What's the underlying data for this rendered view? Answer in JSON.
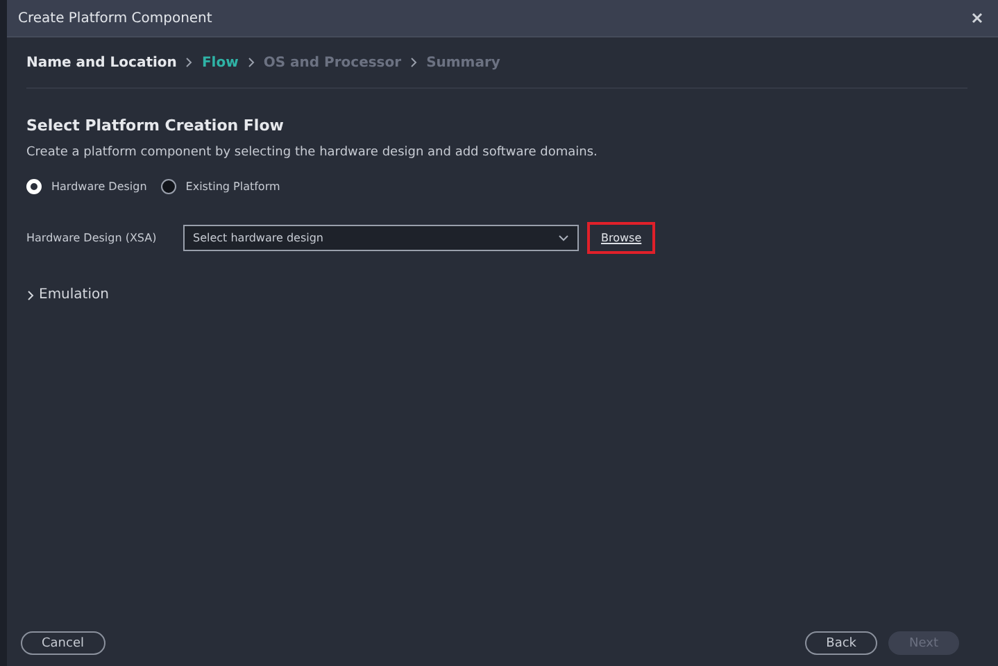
{
  "window": {
    "title": "Create Platform Component"
  },
  "steps": [
    {
      "label": "Name and Location",
      "selected": false,
      "disabled": false
    },
    {
      "label": "Flow",
      "selected": true,
      "disabled": false
    },
    {
      "label": "OS and Processor",
      "selected": false,
      "disabled": true
    },
    {
      "label": "Summary",
      "selected": false,
      "disabled": true
    }
  ],
  "section": {
    "title": "Select Platform Creation Flow",
    "description": "Create a platform component by selecting the hardware design and add software domains."
  },
  "flow_options": [
    {
      "label": "Hardware Design",
      "selected": true
    },
    {
      "label": "Existing Platform",
      "selected": false
    }
  ],
  "hardware_design": {
    "label": "Hardware Design (XSA)",
    "placeholder": "Select hardware design",
    "browse": {
      "label": "Browse",
      "highlighted": true
    }
  },
  "emulation": {
    "label": "Emulation",
    "expanded": false
  },
  "buttons": [
    {
      "label": "Cancel",
      "disabled": false
    },
    {
      "label": "Back",
      "disabled": false
    },
    {
      "label": "Next",
      "disabled": true
    }
  ]
}
